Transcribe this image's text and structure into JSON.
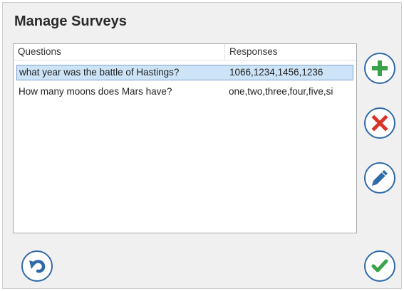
{
  "window": {
    "title": "Manage Surveys"
  },
  "table": {
    "columns": [
      "Questions",
      "Responses"
    ],
    "rows": [
      {
        "question": "what year was the battle of Hastings?",
        "responses": "1066,1234,1456,1236",
        "selected": true
      },
      {
        "question": "How many moons does Mars have?",
        "responses": "one,two,three,four,five,si",
        "selected": false
      }
    ]
  },
  "buttons": {
    "add": {
      "icon": "plus-icon",
      "color": "#3aa34a"
    },
    "delete": {
      "icon": "x-icon",
      "color": "#d9342b"
    },
    "edit": {
      "icon": "pencil-icon",
      "color": "#2f6aa8"
    },
    "undo": {
      "icon": "undo-arrow-icon",
      "color": "#2f6aa8"
    },
    "confirm": {
      "icon": "checkmark-icon",
      "color": "#3aa34a"
    }
  },
  "colors": {
    "selection_bg": "#cde3f7",
    "selection_border": "#7da2ce",
    "button_ring": "#2f6aa8"
  }
}
